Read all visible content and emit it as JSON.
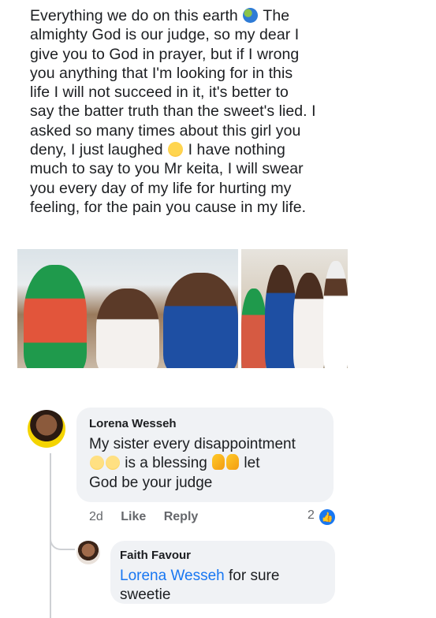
{
  "post": {
    "line1": "Everything we do on this earth",
    "line1b": " The",
    "lines_a": "almighty God is our judge, so  my dear I\ngive you to God in prayer, but if I wrong\nyou anything that I'm looking for in this\nlife I will not succeed in it,  it's better to\nsay the batter truth than the sweet's lied. I\nasked so many times about this girl you\ndeny, I just laughed",
    "lines_b": " I have nothing\nmuch to say to you Mr keita, I will swear\nyou every day of my life for hurting my\nfeeling, for the pain you cause in my life."
  },
  "comment": {
    "author": "Lorena Wesseh",
    "text_1": "My sister every disappointment",
    "text_2": " is a blessing ",
    "text_2b": " let",
    "text_3": "God be your judge",
    "time": "2d",
    "like_label": "Like",
    "reply_label": "Reply",
    "reaction_count": "2"
  },
  "reply": {
    "author": "Faith Favour",
    "mention": "Lorena Wesseh",
    "text_1": " for sure",
    "text_2": "sweetie"
  },
  "icons": {
    "globe": "globe-emoji",
    "laugh": "rofl-emoji",
    "sad": "disappointed-emoji",
    "pray": "folded-hands-emoji",
    "like": "like-thumb-icon"
  },
  "colors": {
    "link": "#1877f2",
    "bubble": "#f0f2f5",
    "meta": "#65676b"
  }
}
